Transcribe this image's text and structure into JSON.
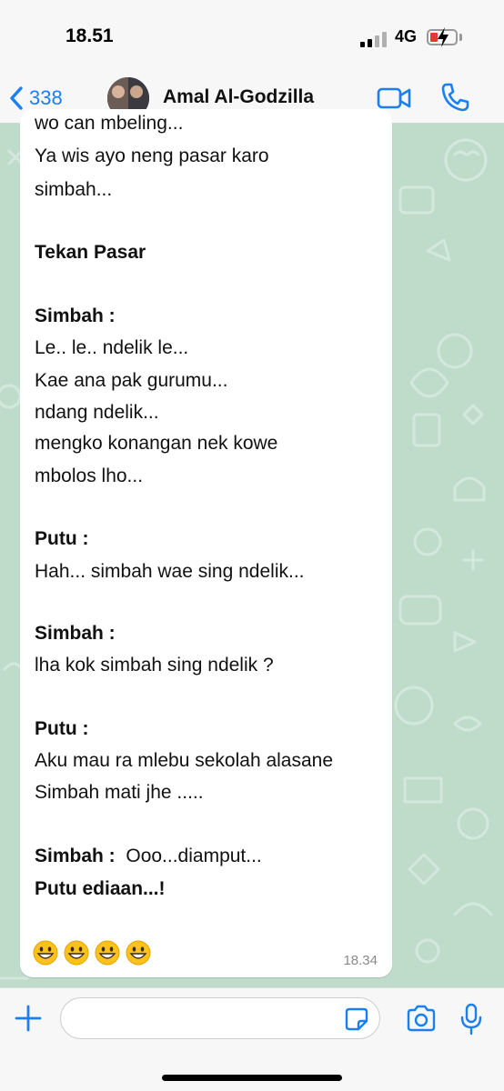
{
  "status_bar": {
    "time": "18.51",
    "network": "4G"
  },
  "header": {
    "back_count": "338",
    "contact_name": "Amal Al-Godzilla"
  },
  "message": {
    "lines": [
      {
        "text": "wo can mbeling...",
        "bold": false
      },
      {
        "text": "Ya wis ayo neng pasar karo",
        "bold": false
      },
      {
        "text": "simbah...",
        "bold": false
      },
      {
        "text": "Tekan Pasar",
        "bold": true
      },
      {
        "text": "Simbah  :",
        "bold": true
      },
      {
        "text": "Le.. le.. ndelik le...",
        "bold": false
      },
      {
        "text": "Kae ana pak gurumu...",
        "bold": false
      },
      {
        "text": "ndang ndelik...",
        "bold": false
      },
      {
        "text": "mengko konangan nek kowe",
        "bold": false
      },
      {
        "text": "mbolos lho...",
        "bold": false
      },
      {
        "text": "Putu  :",
        "bold": true
      },
      {
        "text": "Hah... simbah wae sing ndelik...",
        "bold": false
      },
      {
        "text": "Simbah  :",
        "bold": true
      },
      {
        "text": "lha kok simbah sing ndelik ?",
        "bold": false
      },
      {
        "text": "Putu  :",
        "bold": true
      },
      {
        "text": "Aku mau ra  mlebu sekolah alasane",
        "bold": false
      },
      {
        "text": "Simbah mati jhe  .....",
        "bold": false
      },
      {
        "speaker": "Simbah :",
        "text": "  Ooo...diamput...",
        "bold": false
      },
      {
        "text": "Putu ediaan...!",
        "bold": true
      }
    ],
    "emojis": [
      "grinning-face",
      "grinning-face",
      "grinning-face",
      "grinning-face"
    ],
    "time": "18.34"
  },
  "composer": {
    "placeholder": ""
  },
  "colors": {
    "accent": "#1a7ff3",
    "wallpaper": "#bfdccb",
    "bubble": "#ffffff",
    "battery_low": "#e53935"
  }
}
